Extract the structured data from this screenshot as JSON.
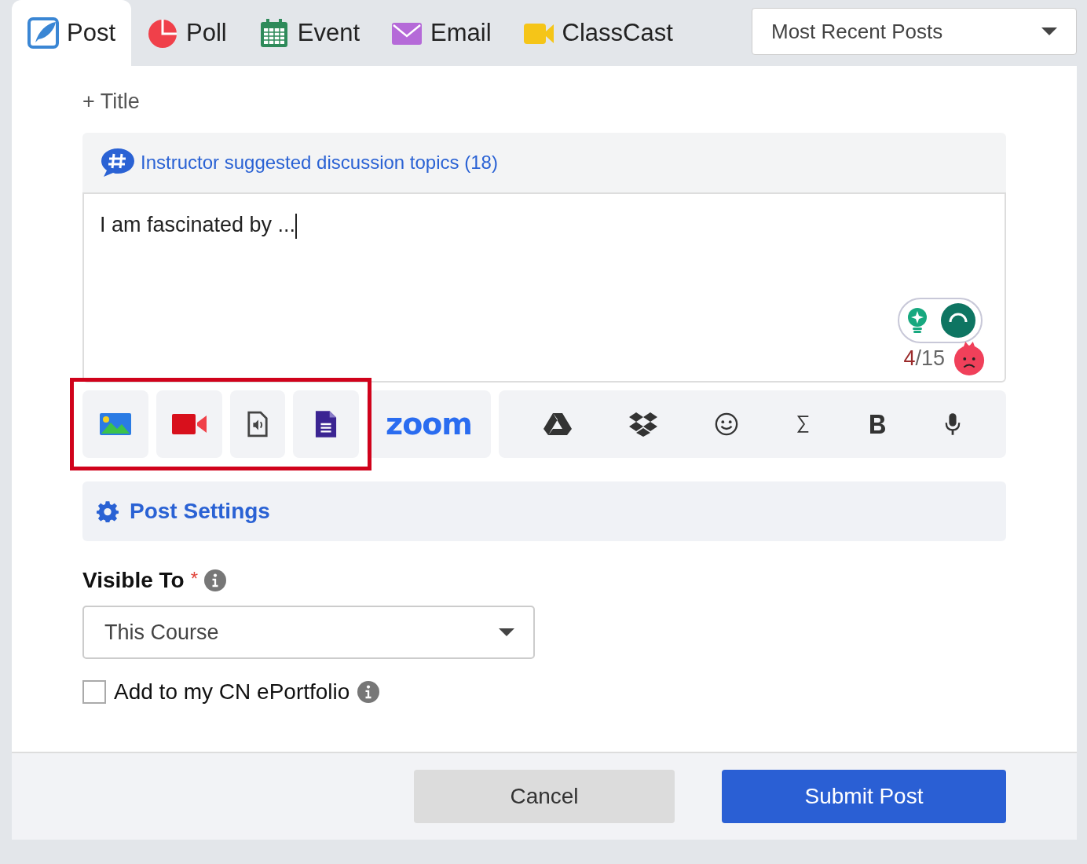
{
  "tabs": [
    {
      "kind": "post",
      "label": "Post",
      "selected": true
    },
    {
      "kind": "poll",
      "label": "Poll",
      "selected": false
    },
    {
      "kind": "event",
      "label": "Event",
      "selected": false
    },
    {
      "kind": "email",
      "label": "Email",
      "selected": false
    },
    {
      "kind": "classcast",
      "label": "ClassCast",
      "selected": false
    }
  ],
  "sort_select": {
    "value": "Most Recent Posts"
  },
  "title_toggle": "+ Title",
  "topics_link": "Instructor suggested discussion topics (18)",
  "editor": {
    "value": "I am fascinated by ...",
    "word_count": "4",
    "word_goal": "/15"
  },
  "toolbar": {
    "highlighted": true,
    "media_tools": [
      {
        "kind": "image"
      },
      {
        "kind": "video"
      },
      {
        "kind": "audio"
      },
      {
        "kind": "document"
      }
    ],
    "zoom_label": "zoom",
    "tools": [
      {
        "kind": "drive"
      },
      {
        "kind": "dropbox"
      },
      {
        "kind": "emoji"
      },
      {
        "kind": "sigma"
      },
      {
        "kind": "bold"
      },
      {
        "kind": "mic"
      }
    ]
  },
  "post_settings": "Post Settings",
  "visible_to": {
    "label": "Visible To",
    "required_mark": "*",
    "value": "This Course"
  },
  "portfolio": {
    "label": "Add to my CN ePortfolio",
    "checked": false
  },
  "buttons": {
    "cancel": "Cancel",
    "submit": "Submit Post"
  }
}
